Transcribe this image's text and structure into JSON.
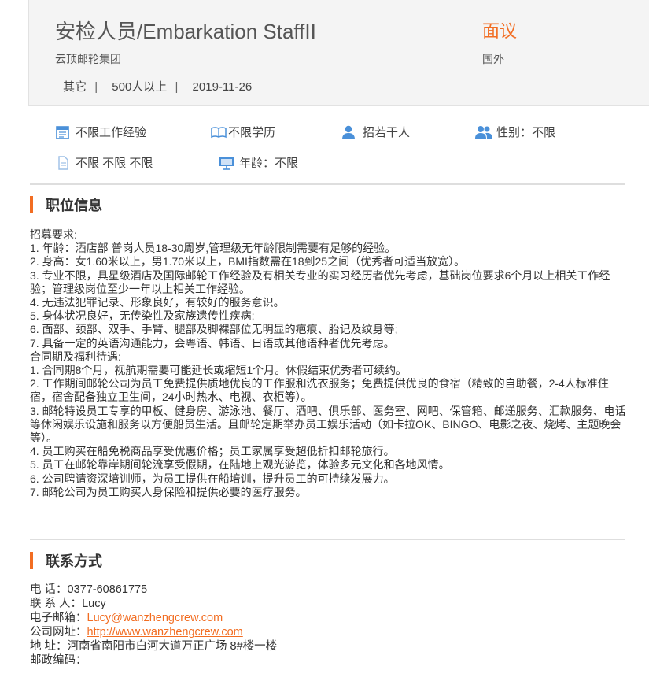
{
  "header": {
    "title": "安检人员/Embarkation StaffII",
    "salary": "面议",
    "company": "云顶邮轮集团",
    "location": "国外",
    "meta": [
      "其它",
      "500人以上",
      "2019-11-26"
    ],
    "meta_separator": "|"
  },
  "requirements": {
    "experience": "不限工作经验",
    "education": "不限学历",
    "headcount": "招若干人",
    "gender": "性别：不限",
    "other": "不限 不限 不限",
    "age": "年龄：不限"
  },
  "sections": {
    "job_info": "职位信息",
    "contact": "联系方式"
  },
  "description_lines": [
    "招募要求:",
    "1. 年龄：酒店部 普岗人员18-30周岁,管理级无年龄限制需要有足够的经验。",
    "2. 身高：女1.60米以上，男1.70米以上，BMI指数需在18到25之间（优秀者可适当放宽）。",
    "3. 专业不限，具星级酒店及国际邮轮工作经验及有相关专业的实习经历者优先考虑，基础岗位要求6个月以上相关工作经验；管理级岗位至少一年以上相关工作经验。",
    "4. 无违法犯罪记录、形象良好，有较好的服务意识。",
    "5. 身体状况良好，无传染性及家族遗传性疾病;",
    "6. 面部、颈部、双手、手臂、腿部及脚裸部位无明显的疤痕、胎记及纹身等;",
    "7. 具备一定的英语沟通能力，会粤语、韩语、日语或其他语种者优先考虑。",
    "合同期及福利待遇:",
    "1. 合同期8个月，视航期需要可能延长或缩短1个月。休假结束优秀者可续约。",
    "2. 工作期间邮轮公司为员工免费提供质地优良的工作服和洗衣服务；免费提供优良的食宿（精致的自助餐，2-4人标准住宿，宿舍配备独立卫生间，24小时热水、电视、衣柜等）。",
    "3. 邮轮特设员工专享的甲板、健身房、游泳池、餐厅、酒吧、俱乐部、医务室、网吧、保管箱、邮递服务、汇款服务、电话等休闲娱乐设施和服务以方便船员生活。且邮轮定期举办员工娱乐活动（如卡拉OK、BINGO、电影之夜、烧烤、主题晚会等）。",
    "4. 员工购买在船免税商品享受优惠价格；员工家属享受超低折扣邮轮旅行。",
    "5. 员工在邮轮靠岸期间轮流享受假期，在陆地上观光游览，体验多元文化和各地风情。",
    "6. 公司聘请资深培训师，为员工提供在船培训，提升员工的可持续发展力。",
    "7. 邮轮公司为员工购买人身保险和提供必要的医疗服务。"
  ],
  "contact": {
    "phone_label": "电 话：",
    "phone": "0377-60861775",
    "person_label": "联 系 人：",
    "person": "Lucy",
    "email_label": "电子邮箱：",
    "email": "Lucy@wanzhengcrew.com",
    "website_label": "公司网址：",
    "website": "http://www.wanzhengcrew.com",
    "address_label": "地 址：",
    "address": "河南省南阳市白河大道万正广场 8#楼一楼",
    "postcode_label": "邮政编码："
  },
  "colors": {
    "accent": "#f26d22",
    "icon_blue": "#4a90d9",
    "header_bg": "#f4f4f4"
  },
  "icons": [
    "calendar-icon",
    "book-icon",
    "person-icon",
    "people-icon",
    "document-icon",
    "presentation-icon"
  ]
}
